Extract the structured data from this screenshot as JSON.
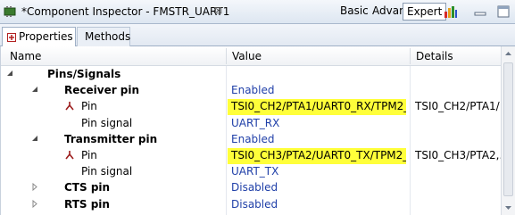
{
  "window": {
    "title": "*Component Inspector - FMSTR_UART1",
    "close_glyph": "⊠",
    "modes": [
      "Basic",
      "Advanced",
      "Expert"
    ],
    "active_mode": "Expert"
  },
  "tabs": [
    {
      "label": "Properties",
      "active": true
    },
    {
      "label": "Methods",
      "active": false
    }
  ],
  "table": {
    "columns": [
      "Name",
      "Value",
      "Details"
    ],
    "rows": [
      {
        "name": "Pins/Signals",
        "value": "",
        "details": "",
        "level": 0,
        "bold": true,
        "expander": "expanded",
        "pin": false,
        "highlight": false
      },
      {
        "name": "Receiver pin",
        "value": "Enabled",
        "details": "",
        "level": 1,
        "bold": true,
        "expander": "expanded",
        "pin": false,
        "highlight": false
      },
      {
        "name": "Pin",
        "value": "TSI0_CH2/PTA1/UART0_RX/TPM2_...",
        "details": "TSI0_CH2/PTA1/...",
        "level": 2,
        "bold": false,
        "expander": "none",
        "pin": true,
        "highlight": true
      },
      {
        "name": "Pin signal",
        "value": "UART_RX",
        "details": "",
        "level": 2,
        "bold": false,
        "expander": "none",
        "pin": false,
        "highlight": false
      },
      {
        "name": "Transmitter pin",
        "value": "Enabled",
        "details": "",
        "level": 1,
        "bold": true,
        "expander": "expanded",
        "pin": false,
        "highlight": false
      },
      {
        "name": "Pin",
        "value": "TSI0_CH3/PTA2/UART0_TX/TPM2_...",
        "details": "TSI0_CH3/PTA2,...",
        "level": 2,
        "bold": false,
        "expander": "none",
        "pin": true,
        "highlight": true
      },
      {
        "name": "Pin signal",
        "value": "UART_TX",
        "details": "",
        "level": 2,
        "bold": false,
        "expander": "none",
        "pin": false,
        "highlight": false
      },
      {
        "name": "CTS pin",
        "value": "Disabled",
        "details": "",
        "level": 1,
        "bold": true,
        "expander": "collapsed",
        "pin": false,
        "highlight": false
      },
      {
        "name": "RTS pin",
        "value": "Disabled",
        "details": "",
        "level": 1,
        "bold": true,
        "expander": "collapsed",
        "pin": false,
        "highlight": false
      }
    ]
  },
  "colors": {
    "value_blue": "#1f3fa8",
    "highlight": "#ffff3a",
    "pin_icon": "#9c1c1c"
  },
  "icons": {
    "app": "component-icon",
    "close": "close-icon",
    "chart": "bar-chart-icon",
    "minimize": "minimize-icon",
    "maximize": "maximize-icon",
    "properties_tab": "properties-icon",
    "pin": "pin-icon"
  }
}
